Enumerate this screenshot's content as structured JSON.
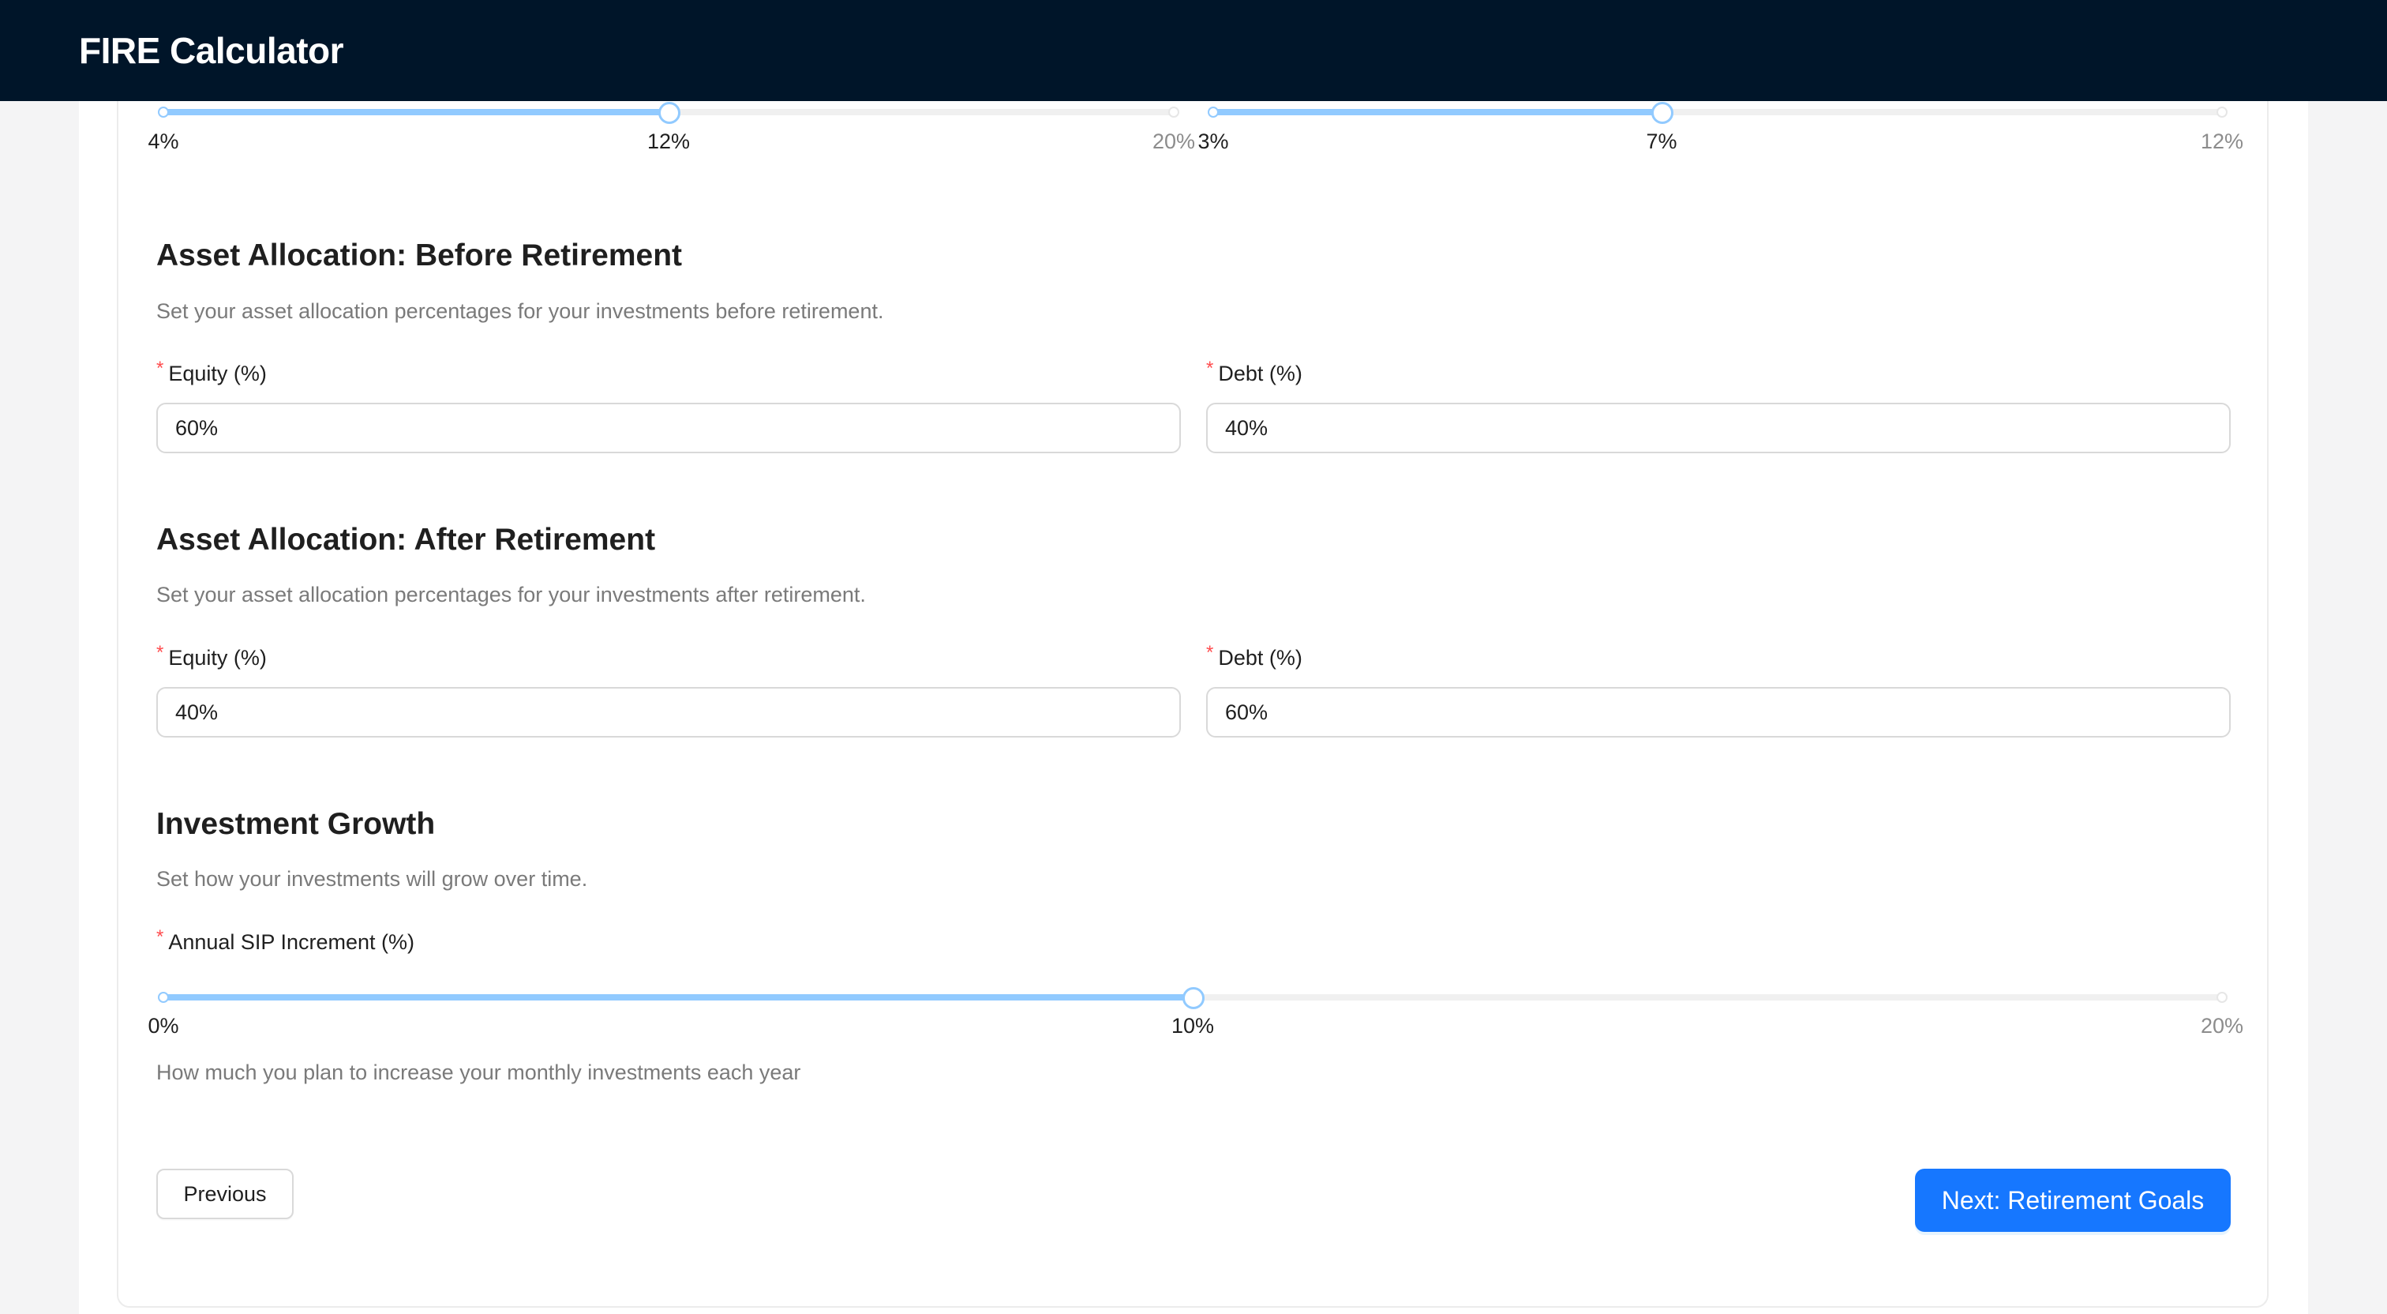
{
  "app": {
    "title": "FIRE Calculator"
  },
  "top_sliders": [
    {
      "min_label": "4%",
      "value_label": "12%",
      "max_label": "20%",
      "min": 4,
      "max": 20,
      "value": 12
    },
    {
      "min_label": "3%",
      "value_label": "7%",
      "max_label": "12%",
      "min": 3,
      "max": 12,
      "value": 7
    }
  ],
  "before_retirement": {
    "title": "Asset Allocation: Before Retirement",
    "description": "Set your asset allocation percentages for your investments before retirement.",
    "equity_label": "Equity (%)",
    "equity_value": "60%",
    "debt_label": "Debt (%)",
    "debt_value": "40%"
  },
  "after_retirement": {
    "title": "Asset Allocation: After Retirement",
    "description": "Set your asset allocation percentages for your investments after retirement.",
    "equity_label": "Equity (%)",
    "equity_value": "40%",
    "debt_label": "Debt (%)",
    "debt_value": "60%"
  },
  "growth": {
    "title": "Investment Growth",
    "description": "Set how your investments will grow over time.",
    "sip_label": "Annual SIP Increment (%)",
    "sip_slider": {
      "min_label": "0%",
      "value_label": "10%",
      "max_label": "20%",
      "min": 0,
      "max": 20,
      "value": 10
    },
    "sip_help": "How much you plan to increase your monthly investments each year"
  },
  "buttons": {
    "previous": "Previous",
    "next": "Next: Retirement Goals"
  },
  "colors": {
    "navbar": "#001529",
    "primary": "#1677ff",
    "slider_track": "#91caff",
    "required": "#ff4d4f"
  }
}
